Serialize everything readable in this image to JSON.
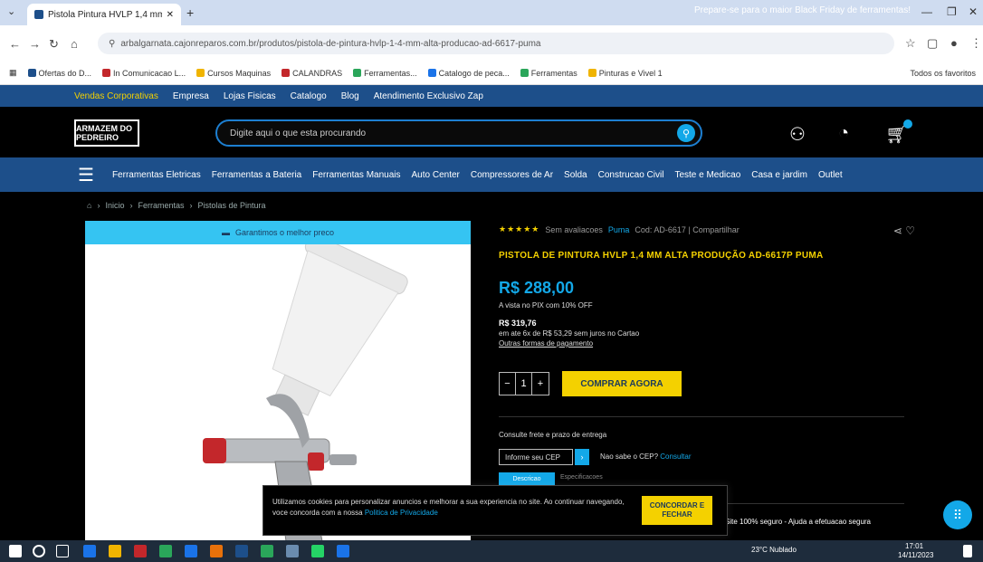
{
  "browser": {
    "tab_title": "Pistola Pintura HVLP 1,4 mm ...",
    "close_glyph": "✕",
    "newtab_glyph": "+",
    "url": "arbalgarnata.cajonreparos.com.br/produtos/pistola-de-pintura-hvlp-1-4-mm-alta-producao-ad-6617-puma",
    "bookmarks": [
      {
        "label": "Ofertas do D...",
        "color": "#1d4f8a"
      },
      {
        "label": "In Comunicacao L...",
        "color": "#c3272b"
      },
      {
        "label": "Cursos Maquinas",
        "color": "#f0b400"
      },
      {
        "label": "CALANDRAS",
        "color": "#c3272b"
      },
      {
        "label": "Ferramentas...",
        "color": "#2aa65a"
      },
      {
        "label": "Catalogo de peca...",
        "color": "#1a73e8"
      },
      {
        "label": "Ferramentas",
        "color": "#2aa65a"
      },
      {
        "label": "Pinturas e Vivel 1",
        "color": "#f0b400"
      }
    ],
    "bookmarks_right": "Todos os favoritos"
  },
  "utilbar": {
    "links": [
      "Vendas Corporativas",
      "Empresa",
      "Lojas Fisicas",
      "Catalogo",
      "Blog",
      "Atendimento Exclusivo Zap"
    ],
    "right_text": "Prepare-se para o maior Black Friday de ferramentas!"
  },
  "header": {
    "logo_text": "ARMAZEM DO PEDREIRO",
    "search_placeholder": "Digite aqui o que esta procurando"
  },
  "categories": [
    "Ferramentas Eletricas",
    "Ferramentas a Bateria",
    "Ferramentas Manuais",
    "Auto Center",
    "Compressores de Ar",
    "Solda",
    "Construcao Civil",
    "Teste e Medicao",
    "Casa e jardim",
    "Outlet"
  ],
  "breadcrumb": [
    "Inicio",
    "Ferramentas",
    "Pistolas de Pintura"
  ],
  "product": {
    "banner": "Garantimos o melhor preco",
    "stars": "★★★★★",
    "rating_text": "Sem avaliacoes",
    "brand": "Puma",
    "sku": "Cod: AD-6617 | Compartilhar",
    "title": "PISTOLA DE PINTURA HVLP 1,4 MM ALTA PRODUÇÃO AD-6617P PUMA",
    "price": "R$ 288,00",
    "price_note": "A vista no PIX com 10% OFF",
    "old_price": "R$ 319,76",
    "installments": "em ate 6x de R$ 53,29 sem juros no Cartao",
    "pay_forms": "Outras formas de pagamento",
    "qty_minus": "−",
    "qty": "1",
    "qty_plus": "+",
    "buy_label": "COMPRAR AGORA",
    "shipping_label": "Consulte frete e prazo de entrega",
    "cep_placeholder": "Informe seu CEP",
    "cep_help": "Nao sabe o CEP?",
    "cep_help_link": "Consultar",
    "tab1": "Descricao",
    "tab2": "Especificacoes",
    "security_text": "Site 100% seguro - Ajuda a efetuacao segura"
  },
  "cookie": {
    "text": "Utilizamos cookies para personalizar anuncios e melhorar a sua experiencia no site. Ao continuar navegando, voce concorda com a nossa",
    "link": "Politica de Privacidade",
    "button": "CONCORDAR E FECHAR"
  },
  "taskbar": {
    "weather": "23°C Nublado",
    "time": "17:01",
    "date": "14/11/2023"
  }
}
